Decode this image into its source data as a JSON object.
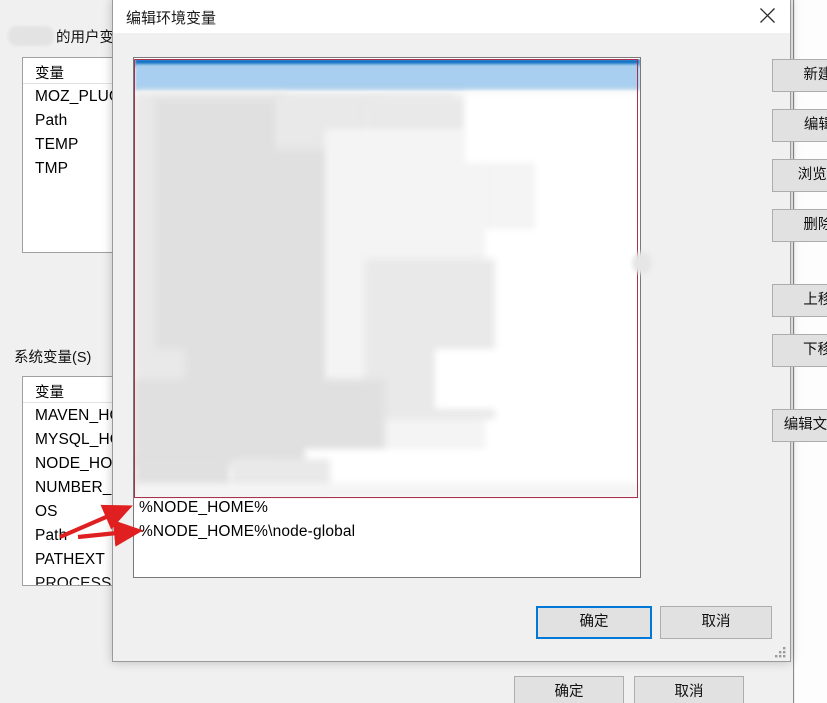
{
  "background_window": {
    "user_vars_label": "的用户变量",
    "user_vars_masked_name": "",
    "user_table_header": "变量",
    "user_rows": [
      "MOZ_PLUG",
      "Path",
      "TEMP",
      "TMP"
    ],
    "system_vars_label": "系统变量(S)",
    "system_table_header": "变量",
    "system_rows": [
      "MAVEN_HO",
      "MYSQL_HO",
      "NODE_HOM",
      "NUMBER_O",
      "OS",
      "Path",
      "PATHEXT",
      "PROCESSO"
    ],
    "ok_label": "确定",
    "cancel_label": "取消"
  },
  "dialog": {
    "title": "编辑环境变量",
    "close_icon": "close-icon",
    "entries": [
      "%NODE_HOME%",
      "%NODE_HOME%\\node-global"
    ],
    "side_buttons": [
      {
        "label": "新建(N)",
        "name": "new-button"
      },
      {
        "label": "编辑(E)",
        "name": "edit-button"
      },
      {
        "label": "浏览(B)...",
        "name": "browse-button"
      },
      {
        "label": "删除(D)",
        "name": "delete-button"
      },
      {
        "label": "上移(U)",
        "name": "move-up-button"
      },
      {
        "label": "下移(O)",
        "name": "move-down-button"
      },
      {
        "label": "编辑文本(T)...",
        "name": "edit-text-button"
      }
    ],
    "ok_label": "确定",
    "cancel_label": "取消",
    "resize_grip": "resize-grip-icon"
  },
  "annotations": {
    "highlight_color": "#a8324a",
    "arrow_color": "#e02020",
    "arrow_count": 2
  }
}
